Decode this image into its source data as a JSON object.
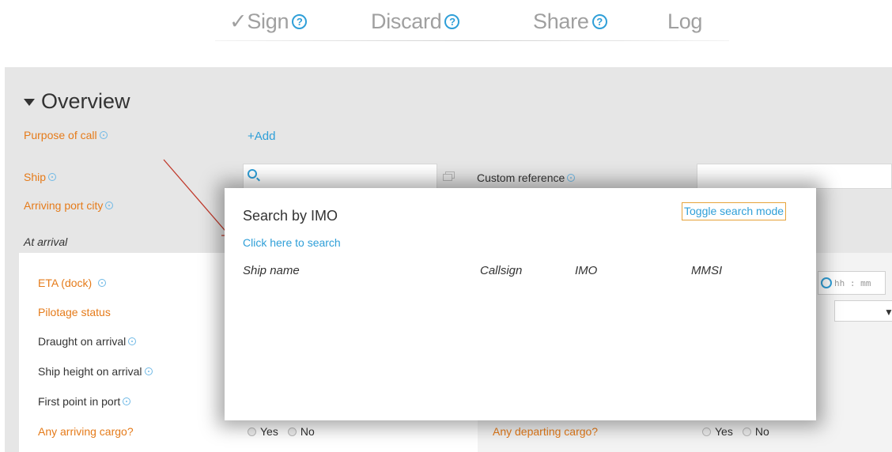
{
  "toolbar": {
    "sign_label": "✓Sign",
    "discard_label": "Discard",
    "share_label": "Share",
    "log_label": "Log",
    "help_glyph": "?"
  },
  "section": {
    "title": "Overview"
  },
  "form": {
    "purpose_of_call": "Purpose of call",
    "add_label": "+Add",
    "ship": "Ship",
    "custom_reference": "Custom reference",
    "arriving_port_city": "Arriving port city",
    "at_arrival": "At arrival",
    "eta_dock": "ETA (dock)",
    "pilotage_status": "Pilotage status",
    "draught_on_arrival": "Draught on arrival",
    "ship_height_on_arrival": "Ship height on arrival",
    "first_point_in_port": "First point in port",
    "any_arriving_cargo": "Any arriving cargo?",
    "any_departing_cargo": "Any departing cargo?",
    "yes": "Yes",
    "no": "No",
    "time_placeholder": "hh : mm"
  },
  "modal": {
    "title": "Search by IMO",
    "toggle_label": "Toggle search mode",
    "search_link": "Click here to search",
    "columns": [
      "Ship name",
      "Callsign",
      "IMO",
      "MMSI"
    ]
  },
  "colors": {
    "accent_blue": "#2f9fd8",
    "label_orange": "#e57b1a",
    "panel_grey": "#e6e6e6",
    "annotation_red": "#c0392b"
  }
}
